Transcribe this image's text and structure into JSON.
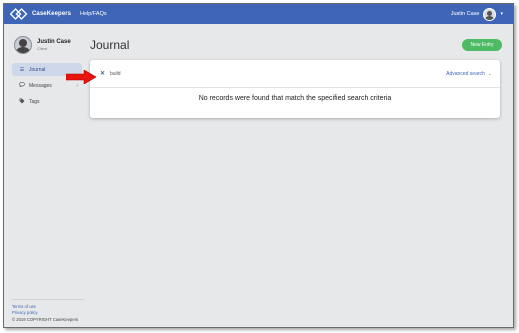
{
  "topbar": {
    "brand": "CaseKeepers",
    "help_link": "Help/FAQs",
    "user_name": "Justin Case",
    "user_caret": "▾"
  },
  "sidebar": {
    "profile": {
      "name": "Justin Case",
      "role": "Client"
    },
    "items": [
      {
        "label": "Journal",
        "icon": "list-icon",
        "glyph": "☰",
        "active": true
      },
      {
        "label": "Messages",
        "icon": "chat-bubble-icon",
        "glyph": "💬",
        "chevron": "›"
      },
      {
        "label": "Tags",
        "icon": "tag-icon",
        "glyph": "🏷"
      }
    ],
    "footer": {
      "terms": "Terms of use",
      "privacy": "Privacy policy",
      "copyright": "© 2019 COPYRIGHT CaseKeepers"
    }
  },
  "main": {
    "title": "Journal",
    "new_entry_label": "New Entry",
    "search": {
      "clear_glyph": "✕",
      "value": "build",
      "advanced_label": "Advanced search",
      "advanced_chevron": "⌄"
    },
    "empty_message": "No records were found that match the specified search criteria"
  },
  "colors": {
    "topbar": "#3f66b6",
    "accent_green": "#4cbb63",
    "arrow_red": "#e8140f",
    "background": "#e7e8ea"
  }
}
